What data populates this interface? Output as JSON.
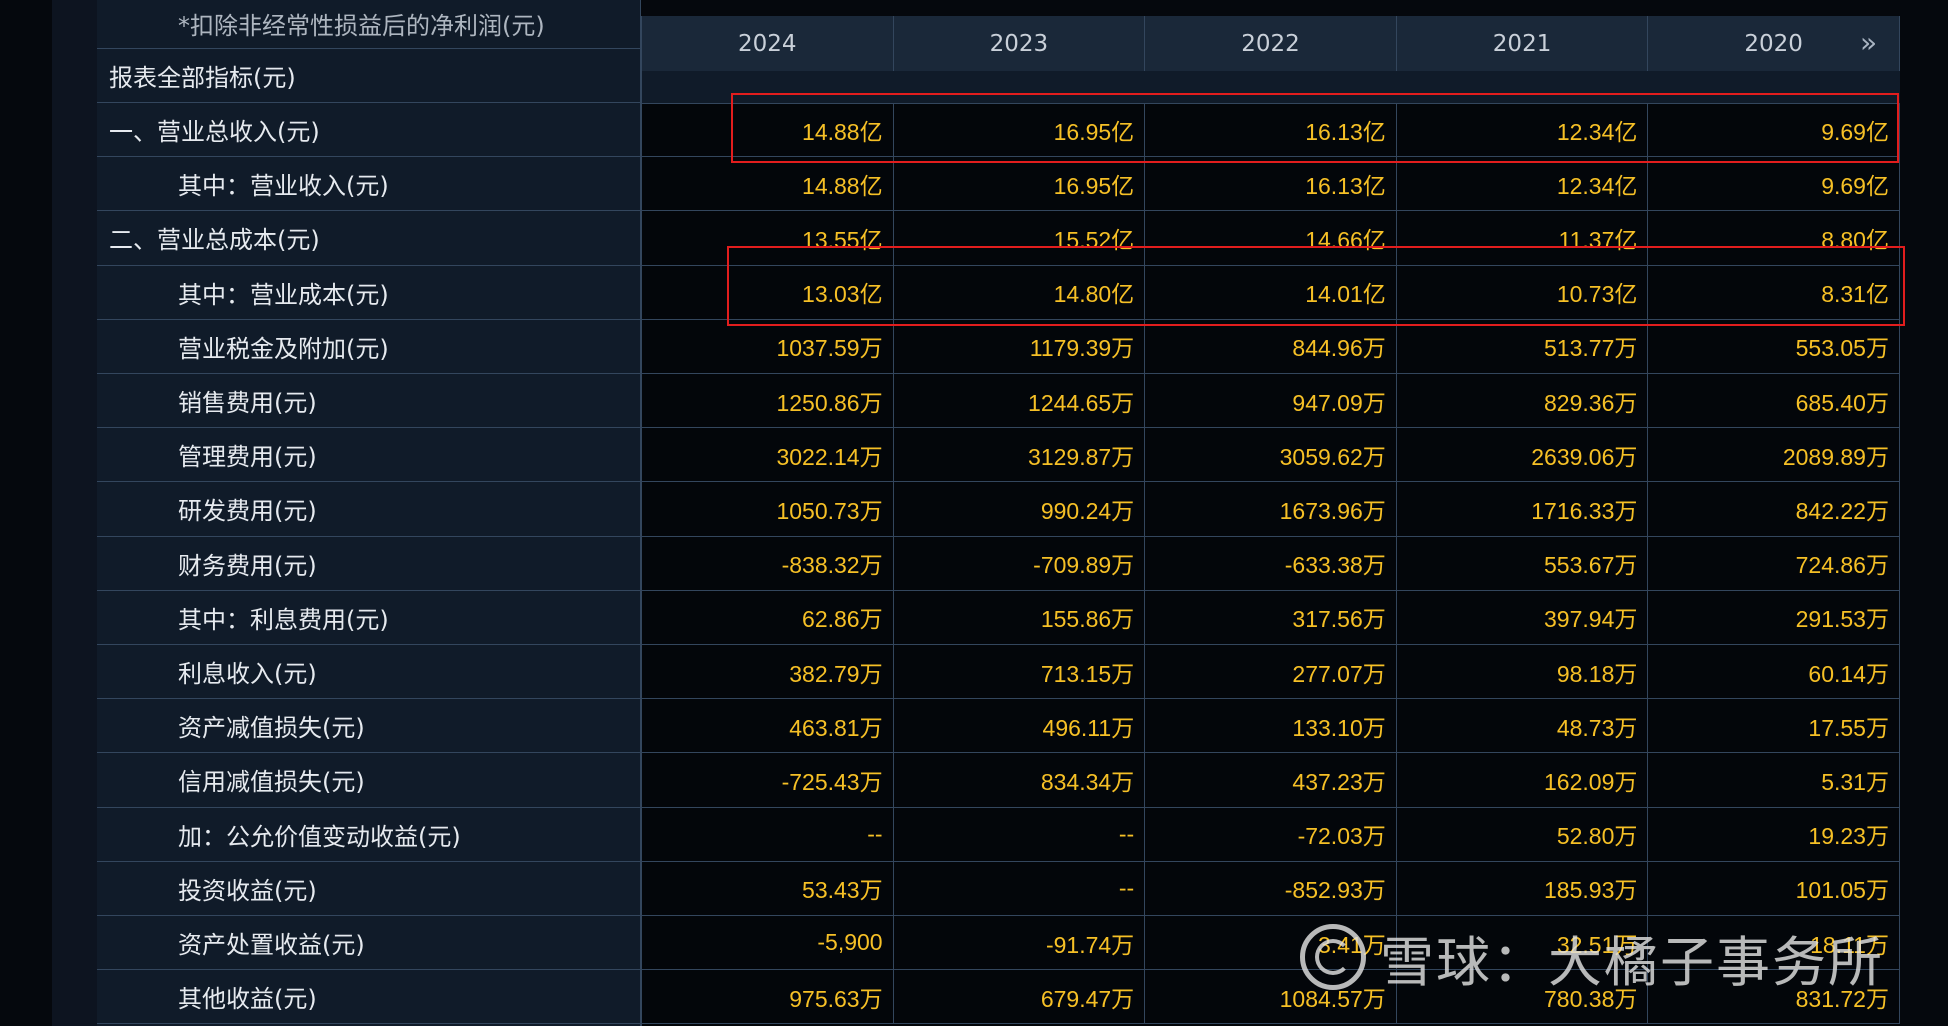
{
  "table": {
    "cut_label": "*扣除非经常性损益后的净利润(元)",
    "section_label": "报表全部指标(元)",
    "years": [
      "2024",
      "2023",
      "2022",
      "2021",
      "2020"
    ],
    "rows": [
      {
        "label": "一、营业总收入(元)",
        "values": [
          "14.88亿",
          "16.95亿",
          "16.13亿",
          "12.34亿",
          "9.69亿"
        ]
      },
      {
        "label": "其中：营业收入(元)",
        "values": [
          "14.88亿",
          "16.95亿",
          "16.13亿",
          "12.34亿",
          "9.69亿"
        ]
      },
      {
        "label": "二、营业总成本(元)",
        "values": [
          "13.55亿",
          "15.52亿",
          "14.66亿",
          "11.37亿",
          "8.80亿"
        ]
      },
      {
        "label": "其中：营业成本(元)",
        "values": [
          "13.03亿",
          "14.80亿",
          "14.01亿",
          "10.73亿",
          "8.31亿"
        ]
      },
      {
        "label": "营业税金及附加(元)",
        "values": [
          "1037.59万",
          "1179.39万",
          "844.96万",
          "513.77万",
          "553.05万"
        ]
      },
      {
        "label": "销售费用(元)",
        "values": [
          "1250.86万",
          "1244.65万",
          "947.09万",
          "829.36万",
          "685.40万"
        ]
      },
      {
        "label": "管理费用(元)",
        "values": [
          "3022.14万",
          "3129.87万",
          "3059.62万",
          "2639.06万",
          "2089.89万"
        ]
      },
      {
        "label": "研发费用(元)",
        "values": [
          "1050.73万",
          "990.24万",
          "1673.96万",
          "1716.33万",
          "842.22万"
        ]
      },
      {
        "label": "财务费用(元)",
        "values": [
          "-838.32万",
          "-709.89万",
          "-633.38万",
          "553.67万",
          "724.86万"
        ]
      },
      {
        "label": "其中：利息费用(元)",
        "values": [
          "62.86万",
          "155.86万",
          "317.56万",
          "397.94万",
          "291.53万"
        ]
      },
      {
        "label": "利息收入(元)",
        "values": [
          "382.79万",
          "713.15万",
          "277.07万",
          "98.18万",
          "60.14万"
        ]
      },
      {
        "label": "资产减值损失(元)",
        "values": [
          "463.81万",
          "496.11万",
          "133.10万",
          "48.73万",
          "17.55万"
        ]
      },
      {
        "label": "信用减值损失(元)",
        "values": [
          "-725.43万",
          "834.34万",
          "437.23万",
          "162.09万",
          "5.31万"
        ]
      },
      {
        "label": "加：公允价值变动收益(元)",
        "values": [
          "--",
          "--",
          "-72.03万",
          "52.80万",
          "19.23万"
        ]
      },
      {
        "label": "投资收益(元)",
        "values": [
          "53.43万",
          "--",
          "-852.93万",
          "185.93万",
          "101.05万"
        ]
      },
      {
        "label": "资产处置收益(元)",
        "values": [
          "-5,900",
          "-91.74万",
          "3.41万",
          "32.51万",
          "18.11万"
        ]
      },
      {
        "label": "其他收益(元)",
        "values": [
          "975.63万",
          "679.47万",
          "1084.57万",
          "780.38万",
          "831.72万"
        ]
      }
    ]
  },
  "watermark": {
    "text": "雪球：大橘子事务所"
  },
  "colors": {
    "value": "#f6c026",
    "highlight": "#e21d1d",
    "grid": "#33465d"
  }
}
